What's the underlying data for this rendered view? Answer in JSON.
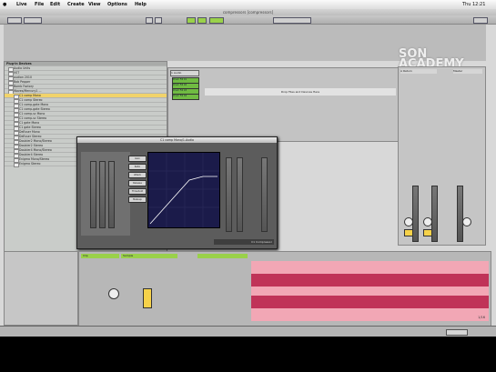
{
  "menubar": {
    "items": [
      "Live",
      "File",
      "Edit",
      "Create",
      "View",
      "Options",
      "Help"
    ],
    "status": "Thu 12:21"
  },
  "window": {
    "title": "compressors  [compressors]"
  },
  "watermark": {
    "line1": "SON",
    "line2": "ACADEMY"
  },
  "browser": {
    "header": "Plug-in Devices",
    "rows": [
      "Audio Units",
      "VST",
      "audion 2010",
      "Bob Pepper",
      "Bomb Factory",
      "Waves/Mercury1 ...",
      "C1 comp Mono",
      "C1 comp Stereo",
      "C1 comp-gate Mono",
      "C1 comp-gate Stereo",
      "C1 comp-sc Mono",
      "C1 comp-sc Stereo",
      "C1 gate Mono",
      "C1 gate Stereo",
      "DeEsser Mono",
      "DeEsser Stereo",
      "Doubler2 Mono/Stereo",
      "Doubler2 Stereo",
      "Doubler4 Mono/Stereo",
      "Doubler4 Stereo",
      "Enigma Mono/Stereo",
      "Enigma Stereo"
    ]
  },
  "session": {
    "track": "1 Audio",
    "drop_text": "Drop Files and Devices Here",
    "clips": [
      "Drum Fill 01",
      "Drum Fill 02",
      "Drum Fill 03",
      "Drum Fill 04"
    ]
  },
  "mixer": {
    "master": "Master",
    "track_b": "A Return"
  },
  "plugin": {
    "title": "C1 comp Mono/1-Audio",
    "brand": "C1 Compressor",
    "buttons": [
      "Gain",
      "Ratio",
      "Attack",
      "Release",
      "Threshold",
      "Makeup"
    ]
  },
  "detail": {
    "clip_name": "Clip",
    "sample": "Sample",
    "page": "1/16"
  },
  "colors": {
    "green": "#9ad14a",
    "highlight": "#f1d36b",
    "wave": "#c03358"
  }
}
